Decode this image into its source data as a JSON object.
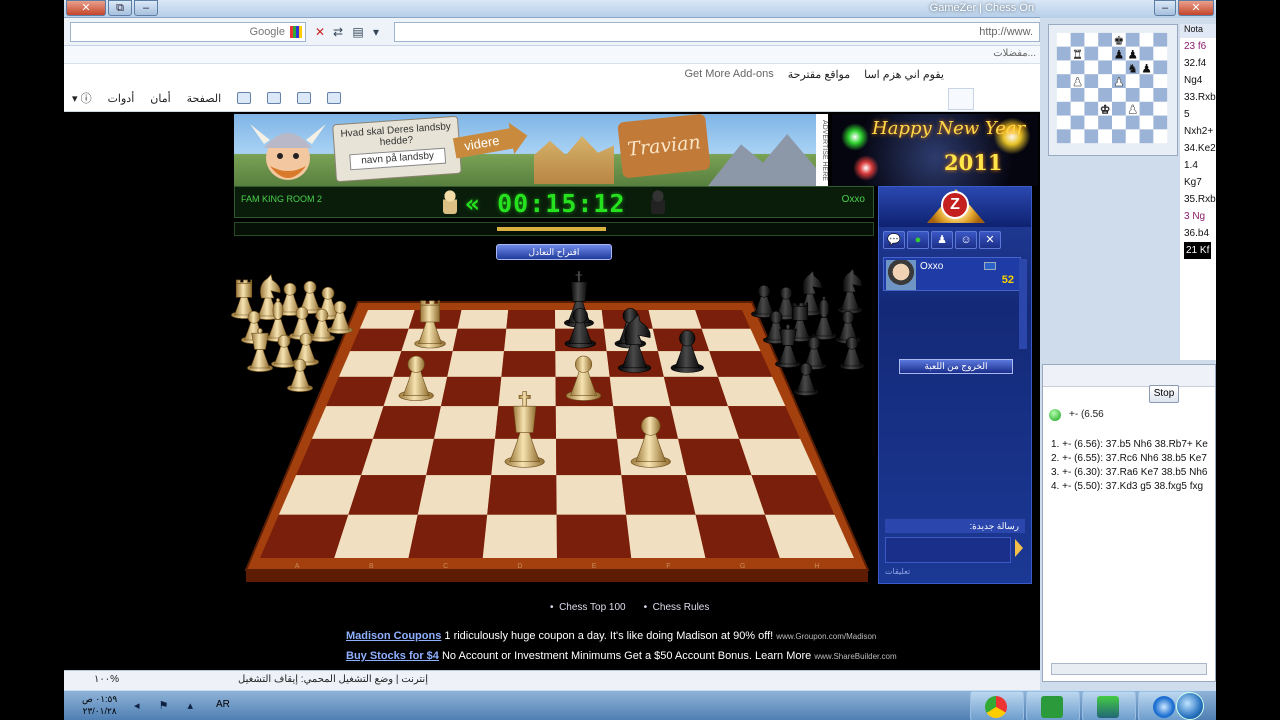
{
  "window": {
    "title": "GameZer | Chess On",
    "close_label": "✕",
    "max_label": "⧉",
    "min_label": "–"
  },
  "search": {
    "engine_label": "Google"
  },
  "address": {
    "value": "http://www."
  },
  "favorites_bar": {
    "text": "...مفضلات"
  },
  "command_links": {
    "suggested_1": "يقوم اني هزم اسا",
    "suggested_2": "مواقع مقترحة",
    "addons": "Get More Add-ons"
  },
  "toolbar": {
    "page": "الصفحة",
    "safety": "أمان",
    "tools": "أدوات"
  },
  "game": {
    "room_name": "FAM KING ROOM 2",
    "clock": "00:15:12",
    "opponent": "Oxxo",
    "offer_draw_label": "اقتراح التعادل",
    "clock_progress": 0.17
  },
  "ad": {
    "prompt": "Hvad skal Deres landsby hedde?",
    "input_placeholder": "navn på landsby",
    "go_label": "videre",
    "brand": "Travian",
    "advertise_label": "ADVERTISE HERE",
    "ny_line1": "Happy New Year",
    "ny_line2": "2011"
  },
  "board": {
    "files": [
      "A",
      "B",
      "C",
      "D",
      "E",
      "F",
      "G",
      "H"
    ],
    "light_square": "#f1dfc2",
    "dark_square": "#7a1f0b",
    "frame": "#a4400d",
    "pieces": [
      {
        "piece": "rook",
        "color": "white",
        "square": "b7"
      },
      {
        "piece": "king",
        "color": "black",
        "square": "e8"
      },
      {
        "piece": "pawn",
        "color": "black",
        "square": "e7"
      },
      {
        "piece": "pawn",
        "color": "black",
        "square": "f7"
      },
      {
        "piece": "pawn",
        "color": "black",
        "square": "g6"
      },
      {
        "piece": "knight",
        "color": "black",
        "square": "f6"
      },
      {
        "piece": "pawn",
        "color": "white",
        "square": "b5"
      },
      {
        "piece": "pawn",
        "color": "white",
        "square": "e5"
      },
      {
        "piece": "king",
        "color": "white",
        "square": "d3"
      },
      {
        "piece": "pawn",
        "color": "white",
        "square": "f3"
      }
    ]
  },
  "side_panel": {
    "player_name": "Oxxo",
    "player_score": "52",
    "leave_label": "الخروج من اللعبة",
    "new_message_label": "رسالة جديدة:",
    "footer": "تعليقات",
    "tab_icons": [
      "chat-icon",
      "status-icon",
      "player-icon",
      "group-icon",
      "tools-icon"
    ]
  },
  "footer": {
    "links": [
      "Chess Top 100",
      "Chess Rules"
    ],
    "ads": [
      {
        "title": "Madison Coupons",
        "text": "1 ridiculously huge coupon a day. It's like doing Madison at 90% off!",
        "source": "www.Groupon.com/Madison"
      },
      {
        "title": "Buy Stocks for $4",
        "text": "No Account or Investment Minimums Get a $50 Account Bonus. Learn More",
        "source": "www.ShareBuilder.com"
      }
    ]
  },
  "status_bar": {
    "zone": "إنترنت | وضع التشغيل المحمي: إيقاف التشغيل",
    "zoom": "١٠٠%"
  },
  "taskbar": {
    "time": "٠١:٥٩ ص",
    "date": "٢٣/٠١/٢٨",
    "lang": "AR"
  },
  "right_window": {
    "title": "Not...",
    "notation_header": "Nota",
    "notation_lines": [
      "23  f6",
      "32.f4",
      "Ng4",
      "33.Rxb",
      "5",
      "Nxh2+",
      "34.Ke2",
      "1.4",
      "Kg7",
      "35.Rxb",
      "3  Ng",
      "36.b4",
      "21  Kf"
    ],
    "eval_header": "+- (6.56",
    "stop_label": "Stop",
    "analysis": [
      "1. +- (6.56): 37.b5 Nh6 38.Rb7+ Ke",
      "2. +- (6.55): 37.Rc6 Nh6 38.b5 Ke7",
      "3. +- (6.30): 37.Ra6 Ke7 38.b5 Nh6",
      "4. +- (5.50): 37.Kd3 g5 38.fxg5 fxg"
    ]
  }
}
